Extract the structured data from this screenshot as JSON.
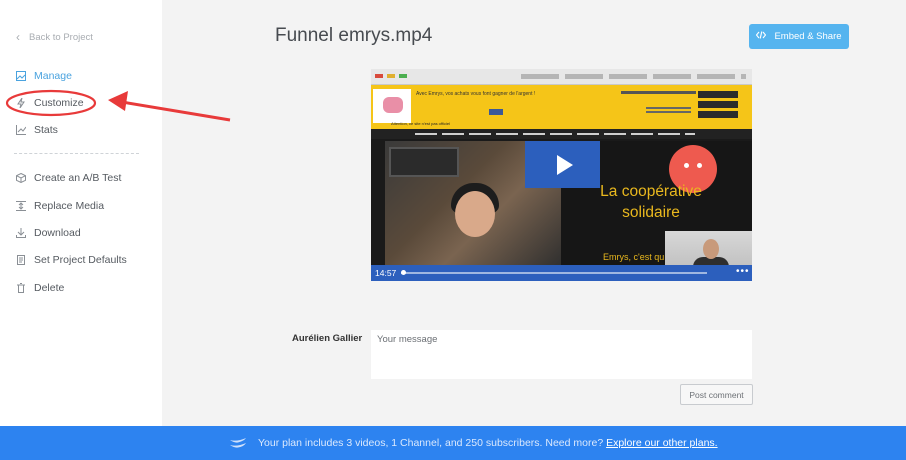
{
  "sidebar": {
    "back_label": "Back to Project",
    "items": [
      {
        "label": "Manage",
        "icon": "image-icon"
      },
      {
        "label": "Customize",
        "icon": "lightning-icon"
      },
      {
        "label": "Stats",
        "icon": "chart-icon"
      },
      {
        "label": "Create an A/B Test",
        "icon": "cube-icon"
      },
      {
        "label": "Replace Media",
        "icon": "replace-icon"
      },
      {
        "label": "Download",
        "icon": "download-icon"
      },
      {
        "label": "Set Project Defaults",
        "icon": "document-icon"
      },
      {
        "label": "Delete",
        "icon": "trash-icon"
      }
    ]
  },
  "header": {
    "title": "Funnel emrys.mp4",
    "embed_label": "Embed & Share"
  },
  "video": {
    "headline": "Avec Emrys, vos achats vous font gagner de l'argent !",
    "warning": "Attention, ce site n'est pas officiel",
    "coop_text": "La coopérative solidaire",
    "coop_sub": "Emrys, c'est qu",
    "time": "14:57"
  },
  "comment": {
    "author": "Aurélien Gallier",
    "placeholder": "Your message",
    "post_label": "Post comment"
  },
  "footer": {
    "text": "Your plan includes 3 videos, 1 Channel, and 250 subscribers. Need more?",
    "link": "Explore our other plans."
  },
  "colors": {
    "accent": "#4aa3df",
    "footer_bg": "#2d83f0",
    "annotation": "#e83a3a",
    "video_accent": "#2c5fbd"
  }
}
